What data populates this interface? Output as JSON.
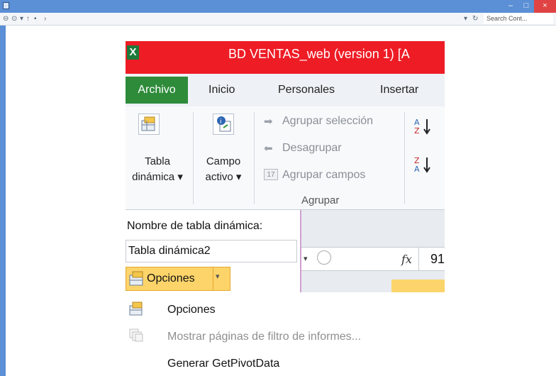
{
  "window": {
    "search_placeholder": "Search Cont...",
    "min": "–",
    "max": "□",
    "close": "×"
  },
  "excel": {
    "logo": "X",
    "title": "BD VENTAS_web (version 1) [A",
    "tabs": [
      "Archivo",
      "Inicio",
      "Personales",
      "Insertar"
    ],
    "ribbon": {
      "tabla_dinamica": [
        "Tabla",
        "dinámica ▾"
      ],
      "campo_activo": [
        "Campo",
        "activo ▾"
      ],
      "agrupar_seleccion": "Agrupar selección",
      "desagrupar": "Desagrupar",
      "agrupar_campos": "Agrupar campos",
      "group_label": "Agrupar"
    },
    "pivot_name_label": "Nombre de tabla dinámica:",
    "pivot_name_value": "Tabla dinámica2",
    "opciones_button": "Opciones",
    "cell_value": "91",
    "fx": "fx"
  },
  "menu": {
    "items": [
      {
        "label": "Opciones",
        "enabled": true
      },
      {
        "label": "Mostrar páginas de filtro de informes...",
        "enabled": false
      },
      {
        "label": "Generar GetPivotData",
        "enabled": true
      }
    ]
  },
  "colors": {
    "title_red": "#ee1c25",
    "archivo_green": "#2e8b3a",
    "highlight": "#fcd46a",
    "window_blue": "#5b8fd6"
  }
}
